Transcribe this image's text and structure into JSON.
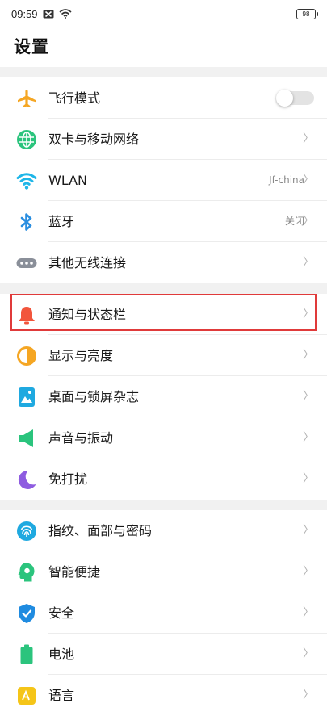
{
  "status_bar": {
    "time": "09:59",
    "battery": "98"
  },
  "header": {
    "title": "设置"
  },
  "groups": [
    {
      "items": [
        {
          "label": "飞行模式",
          "icon": "airplane-icon",
          "color": "#f5a623",
          "control": "toggle",
          "toggle_on": false
        },
        {
          "label": "双卡与移动网络",
          "icon": "globe-icon",
          "color": "#2bc47d",
          "control": "chevron"
        },
        {
          "label": "WLAN",
          "value": "Jf-china",
          "icon": "wifi-icon",
          "color": "#1fb6e8",
          "control": "chevron"
        },
        {
          "label": "蓝牙",
          "value": "关闭",
          "icon": "bluetooth-icon",
          "color": "#2a8ee0",
          "control": "chevron"
        },
        {
          "label": "其他无线连接",
          "icon": "more-connections-icon",
          "color": "#8a8f99",
          "control": "chevron"
        }
      ]
    },
    {
      "items": [
        {
          "label": "通知与状态栏",
          "icon": "bell-icon",
          "color": "#f2553c",
          "control": "chevron"
        },
        {
          "label": "显示与亮度",
          "icon": "brightness-icon",
          "color": "#f5a623",
          "control": "chevron"
        },
        {
          "label": "桌面与锁屏杂志",
          "icon": "wallpaper-icon",
          "color": "#1fa9e0",
          "control": "chevron"
        },
        {
          "label": "声音与振动",
          "icon": "speaker-icon",
          "color": "#2bc47d",
          "control": "chevron"
        },
        {
          "label": "免打扰",
          "icon": "moon-icon",
          "color": "#8e5ce0",
          "control": "chevron"
        }
      ]
    },
    {
      "items": [
        {
          "label": "指纹、面部与密码",
          "icon": "fingerprint-icon",
          "color": "#1fa9e0",
          "control": "chevron"
        },
        {
          "label": "智能便捷",
          "icon": "smart-head-icon",
          "color": "#2bc47d",
          "control": "chevron"
        },
        {
          "label": "安全",
          "icon": "shield-icon",
          "color": "#1f8be0",
          "control": "chevron"
        },
        {
          "label": "电池",
          "icon": "battery-icon",
          "color": "#2bc47d",
          "control": "chevron"
        },
        {
          "label": "语言",
          "icon": "language-icon",
          "color": "#f5c518",
          "control": "chevron"
        }
      ]
    }
  ],
  "chevron_glyph": "〉",
  "highlight_color": "#e03a3a"
}
